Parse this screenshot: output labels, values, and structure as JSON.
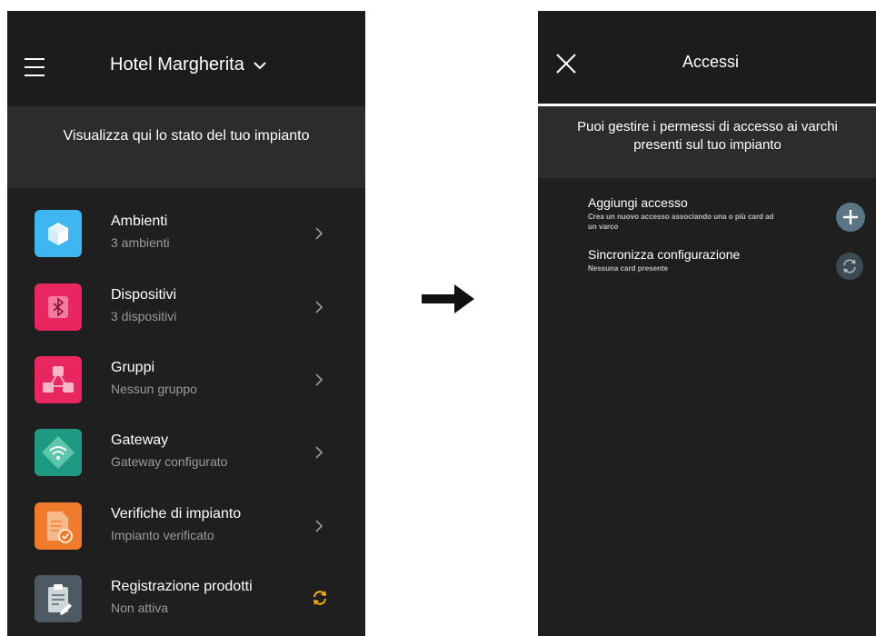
{
  "left_screen": {
    "header": {
      "title": "Hotel Margherita",
      "menu_icon": "hamburger-icon",
      "dropdown_icon": "chevron-down-icon"
    },
    "banner": {
      "text": "Visualizza qui lo stato del tuo impianto"
    },
    "items": [
      {
        "title": "Ambienti",
        "subtitle": "3 ambienti",
        "icon": "cube-icon",
        "color": "#3fb6f0",
        "action_icon": "chevron-right-icon"
      },
      {
        "title": "Dispositivi",
        "subtitle": "3 dispositivi",
        "icon": "bluetooth-icon",
        "color": "#e82760",
        "action_icon": "chevron-right-icon"
      },
      {
        "title": "Gruppi",
        "subtitle": "Nessun gruppo",
        "icon": "group-icon",
        "color": "#e82760",
        "action_icon": "chevron-right-icon"
      },
      {
        "title": "Gateway",
        "subtitle": "Gateway configurato",
        "icon": "wifi-gateway-icon",
        "color": "#1f9a82",
        "action_icon": "chevron-right-icon"
      },
      {
        "title": "Verifiche di impianto",
        "subtitle": "Impianto verificato",
        "icon": "document-check-icon",
        "color": "#f07b2c",
        "action_icon": "chevron-right-icon"
      },
      {
        "title": "Registrazione prodotti",
        "subtitle": "Non attiva",
        "icon": "clipboard-icon",
        "color": "#4d5a63",
        "action_icon": "sync-icon",
        "action_color": "#f5b400"
      }
    ]
  },
  "flow_arrow": {
    "icon": "arrow-right-icon"
  },
  "right_screen": {
    "header": {
      "title": "Accessi",
      "close_icon": "close-icon"
    },
    "banner": {
      "text_line1": "Puoi gestire i permessi di accesso ai varchi",
      "text_line2": "presenti sul tuo impianto"
    },
    "items": [
      {
        "title": "Aggiungi accesso",
        "subtitle": "Crea un nuovo accesso associando una o più card ad un varco",
        "icon": "plus-icon"
      },
      {
        "title": "Sincronizza configurazione",
        "subtitle": "Nessuna card presente",
        "icon": "sync-icon"
      }
    ],
    "accent_color": "#5b7585"
  }
}
